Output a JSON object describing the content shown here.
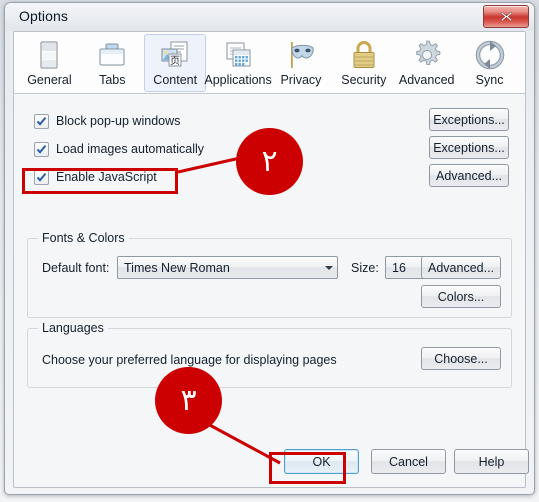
{
  "window": {
    "title": "Options",
    "close_label": "Close",
    "close_icon": "close-x-icon"
  },
  "tabs": [
    {
      "label": "General",
      "icon": "browser-window-icon",
      "selected": false
    },
    {
      "label": "Tabs",
      "icon": "folder-tabs-icon",
      "selected": false
    },
    {
      "label": "Content",
      "icon": "page-content-icon",
      "selected": true
    },
    {
      "label": "Applications",
      "icon": "app-windows-icon",
      "selected": false
    },
    {
      "label": "Privacy",
      "icon": "mask-icon",
      "selected": false
    },
    {
      "label": "Security",
      "icon": "padlock-icon",
      "selected": false
    },
    {
      "label": "Advanced",
      "icon": "gear-icon",
      "selected": false
    },
    {
      "label": "Sync",
      "icon": "sync-arrows-icon",
      "selected": false
    }
  ],
  "content": {
    "checkboxes": [
      {
        "label": "Block pop-up windows",
        "checked": true,
        "accesskey": "B"
      },
      {
        "label": "Load images automatically",
        "checked": true,
        "accesskey": "i"
      },
      {
        "label": "Enable JavaScript",
        "checked": true,
        "accesskey": "J"
      }
    ],
    "side_buttons": [
      {
        "label": "Exceptions..."
      },
      {
        "label": "Exceptions..."
      },
      {
        "label": "Advanced..."
      }
    ],
    "fonts_group": {
      "title": "Fonts & Colors",
      "default_font_label": "Default font:",
      "default_font_value": "Times New Roman",
      "size_label": "Size:",
      "size_value": "16",
      "advanced_button": "Advanced...",
      "colors_button": "Colors..."
    },
    "languages_group": {
      "title": "Languages",
      "description": "Choose your preferred language for displaying pages",
      "choose_button": "Choose..."
    }
  },
  "footer": {
    "ok": "OK",
    "cancel": "Cancel",
    "help": "Help"
  },
  "annotations": {
    "accent_color": "#cc0000",
    "badge_step2": "٢",
    "badge_step3": "٣",
    "highlight_javascript": "Enable JavaScript",
    "highlight_ok": "OK"
  }
}
